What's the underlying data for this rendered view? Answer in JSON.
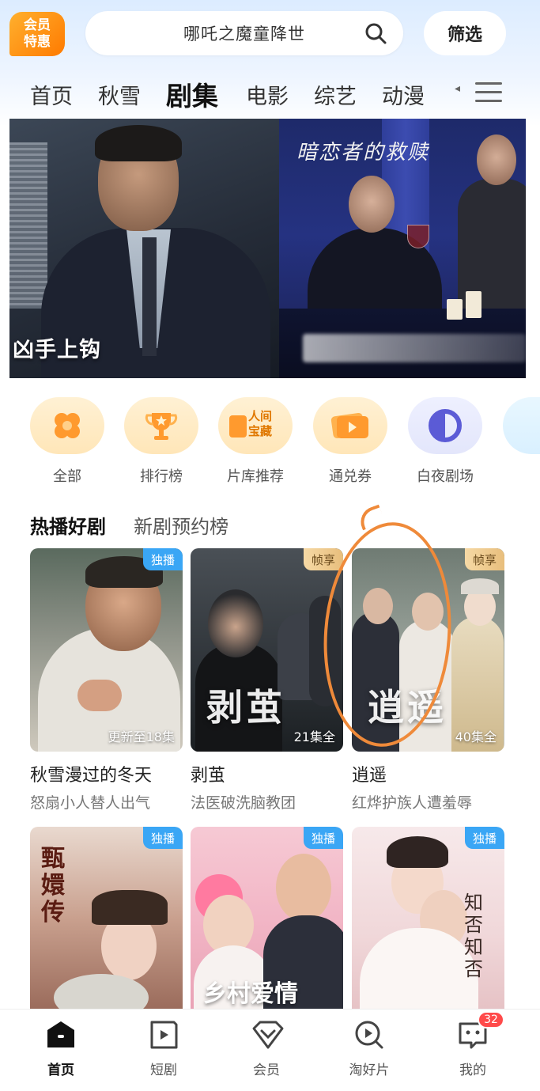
{
  "header": {
    "vip_badge_line1": "会员",
    "vip_badge_line2": "特惠",
    "search_text": "哪吒之魔童降世",
    "filter_label": "筛选"
  },
  "tabs": [
    {
      "label": "首页",
      "active": false
    },
    {
      "label": "秋雪",
      "active": false
    },
    {
      "label": "剧集",
      "active": true
    },
    {
      "label": "电影",
      "active": false
    },
    {
      "label": "综艺",
      "active": false
    },
    {
      "label": "动漫",
      "active": false
    }
  ],
  "banner": {
    "left_title": "凶手上钩",
    "right_title": "暗恋者的救赎"
  },
  "quick_entries": [
    {
      "label": "全部",
      "icon": "flower-icon"
    },
    {
      "label": "排行榜",
      "icon": "trophy-icon"
    },
    {
      "label": "片库推荐",
      "icon": "treasure-icon",
      "icon_text_1": "人间",
      "icon_text_2": "宝藏"
    },
    {
      "label": "通兑券",
      "icon": "ticket-icon"
    },
    {
      "label": "白夜剧场",
      "icon": "moon-icon"
    }
  ],
  "section_tabs": [
    {
      "label": "热播好剧",
      "active": true
    },
    {
      "label": "新剧预约榜",
      "active": false
    }
  ],
  "cards": [
    {
      "title": "秋雪漫过的冬天",
      "subtitle": "怒扇小人替人出气",
      "badge": "独播",
      "episodes": "更新至18集"
    },
    {
      "title": "剥茧",
      "subtitle": "法医破洗脑教团",
      "badge": "帧享",
      "episodes": "21集全",
      "poster_text": "剥茧"
    },
    {
      "title": "逍遥",
      "subtitle": "红烨护族人遭羞辱",
      "badge": "帧享",
      "episodes": "40集全",
      "poster_text": "逍遥"
    },
    {
      "badge": "独播",
      "poster_text": "甄嬛传"
    },
    {
      "badge": "独播",
      "poster_text": "乡村爱情"
    },
    {
      "badge": "独播",
      "poster_text": "知否知否"
    }
  ],
  "bottom_nav": [
    {
      "label": "首页",
      "icon": "home-icon",
      "active": true
    },
    {
      "label": "短剧",
      "icon": "play-icon",
      "active": false
    },
    {
      "label": "会员",
      "icon": "vip-diamond-icon",
      "active": false
    },
    {
      "label": "淘好片",
      "icon": "search-play-icon",
      "active": false
    },
    {
      "label": "我的",
      "icon": "profile-face-icon",
      "active": false,
      "badge": "32"
    }
  ],
  "colors": {
    "accent_orange": "#ff8a00",
    "badge_blue": "#3aa6f5",
    "badge_gold": "#e8be7c",
    "notification_red": "#ff4a4a",
    "annotation_orange": "#ef8a3a"
  }
}
